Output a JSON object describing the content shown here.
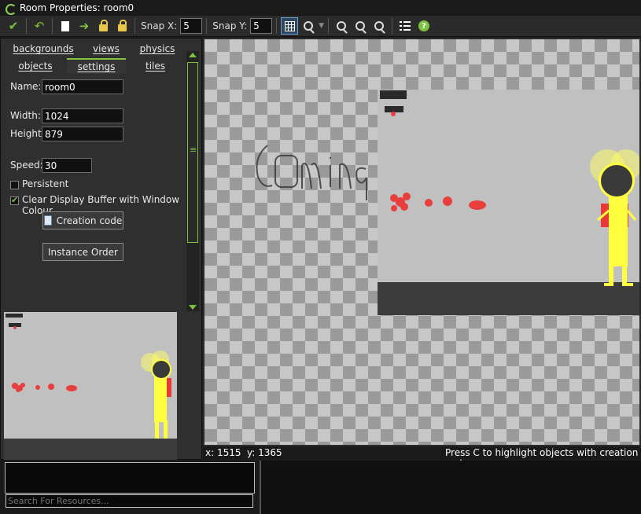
{
  "window": {
    "title": "Room Properties: room0"
  },
  "toolbar": {
    "snap_x_label": "Snap X:",
    "snap_x_value": "5",
    "snap_y_label": "Snap Y:",
    "snap_y_value": "5",
    "icons": [
      "check-icon",
      "undo-icon",
      "new-doc-icon",
      "shift-arrow-icon",
      "lock-icon",
      "lock-all-icon",
      "grid-icon",
      "magnify-icon",
      "zoom-out-icon",
      "zoom-reset-icon",
      "zoom-in-icon",
      "list-icon",
      "help-icon"
    ]
  },
  "tabs": {
    "row1": [
      "backgrounds",
      "views",
      "physics"
    ],
    "row2": [
      "objects",
      "settings",
      "tiles"
    ],
    "active": "settings"
  },
  "settings": {
    "name_label": "Name:",
    "name_value": "room0",
    "width_label": "Width:",
    "width_value": "1024",
    "height_label": "Height:",
    "height_value": "879",
    "speed_label": "Speed:",
    "speed_value": "30",
    "persistent_label": "Persistent",
    "persistent_checked": false,
    "clear_label": "Clear Display Buffer with Window Colour",
    "clear_checked": true,
    "creation_code_label": "Creation code",
    "instance_order_label": "Instance Order"
  },
  "canvas": {
    "handwritten_text": "Coming"
  },
  "status": {
    "x_label": "x: 1515",
    "y_label": "y: 1365",
    "hint": "Press C to highlight objects with creation code"
  },
  "resources": {
    "search_placeholder": "Search For Resources..."
  },
  "colors": {
    "accent": "#7fc242",
    "character": "#ffff40",
    "backpack": "#e83838",
    "blood": "#ee3030",
    "floor": "#3c3c3c",
    "room_bg": "#c0c0c0"
  }
}
